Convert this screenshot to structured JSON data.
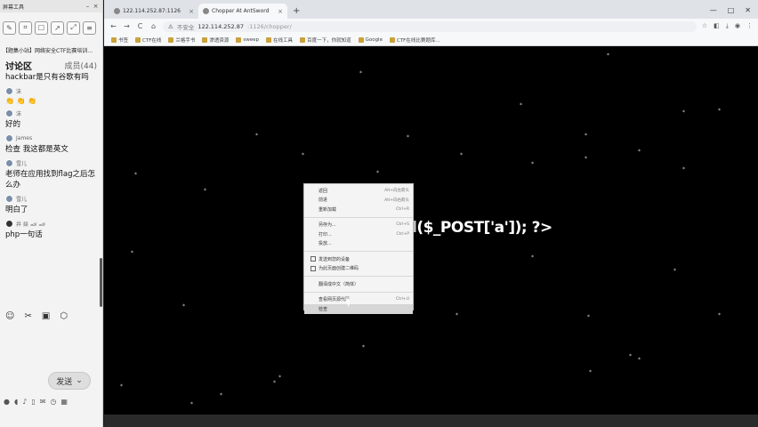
{
  "left_panel": {
    "window_title": "屏幕工具",
    "room_title": "【题集小站】网络安全CTF比赛培训...",
    "tab_discuss": "讨论区",
    "tab_members": "成员(44)",
    "messages": [
      {
        "kind": "text",
        "text": "hackbar是只有谷歌有吗"
      },
      {
        "kind": "name",
        "name": "沫"
      },
      {
        "kind": "emoji",
        "text": "👏 👏 👏"
      },
      {
        "kind": "name",
        "name": "沫"
      },
      {
        "kind": "text",
        "text": "好的"
      },
      {
        "kind": "name",
        "name": "James"
      },
      {
        "kind": "text",
        "text": "检查 我这都是英文"
      },
      {
        "kind": "name",
        "name": "雪儿"
      },
      {
        "kind": "text",
        "text": "老师在应用找到flag之后怎么办"
      },
      {
        "kind": "name",
        "name": "雪儿"
      },
      {
        "kind": "text",
        "text": "明白了"
      },
      {
        "kind": "name",
        "name": "井 燚 🏎 🏎"
      },
      {
        "kind": "text",
        "text": "php一句话"
      }
    ],
    "send_label": "发送",
    "send_caret": "⌄"
  },
  "browser": {
    "tabs": [
      {
        "title": "122.114.252.87:1126",
        "active": false
      },
      {
        "title": "Chopper At AntSword",
        "active": true
      }
    ],
    "new_tab": "+",
    "window_buttons": [
      "—",
      "□",
      "✕"
    ],
    "nav": {
      "back": "←",
      "forward": "→",
      "reload": "C",
      "home": "⌂"
    },
    "url_security": "不安全",
    "url_host": "122.114.252.87",
    "url_path": ":1126/chopper/",
    "bookmarks": [
      "书签",
      "CTF在线",
      "兰格手书",
      "渗透资源",
      "sweep",
      "在线工具",
      "百度一下，你就知道",
      "Google",
      "CTF在线比赛题库..."
    ],
    "page_text": "l($_POST['a']); ?>"
  },
  "context_menu": {
    "items": [
      {
        "label": "返回",
        "shortcut": "Alt+向左箭头",
        "icon": false
      },
      {
        "label": "前进",
        "shortcut": "Alt+向右箭头",
        "icon": false
      },
      {
        "label": "重新加载",
        "shortcut": "Ctrl+R",
        "icon": false
      },
      {
        "sep": true
      },
      {
        "label": "另存为...",
        "shortcut": "Ctrl+S",
        "icon": false
      },
      {
        "label": "打印...",
        "shortcut": "Ctrl+P",
        "icon": false
      },
      {
        "label": "投放...",
        "shortcut": "",
        "icon": false
      },
      {
        "sep": true
      },
      {
        "label": "发送到您的设备",
        "shortcut": "",
        "icon": true
      },
      {
        "label": "为此页面创建二维码",
        "shortcut": "",
        "icon": true
      },
      {
        "sep": true
      },
      {
        "label": "翻译成中文（简体）",
        "shortcut": "",
        "icon": false
      },
      {
        "sep": true
      },
      {
        "label": "查看网页源代码",
        "shortcut": "Ctrl+U",
        "icon": false
      },
      {
        "label": "检查",
        "shortcut": "",
        "icon": false,
        "highlighted": true
      }
    ]
  }
}
